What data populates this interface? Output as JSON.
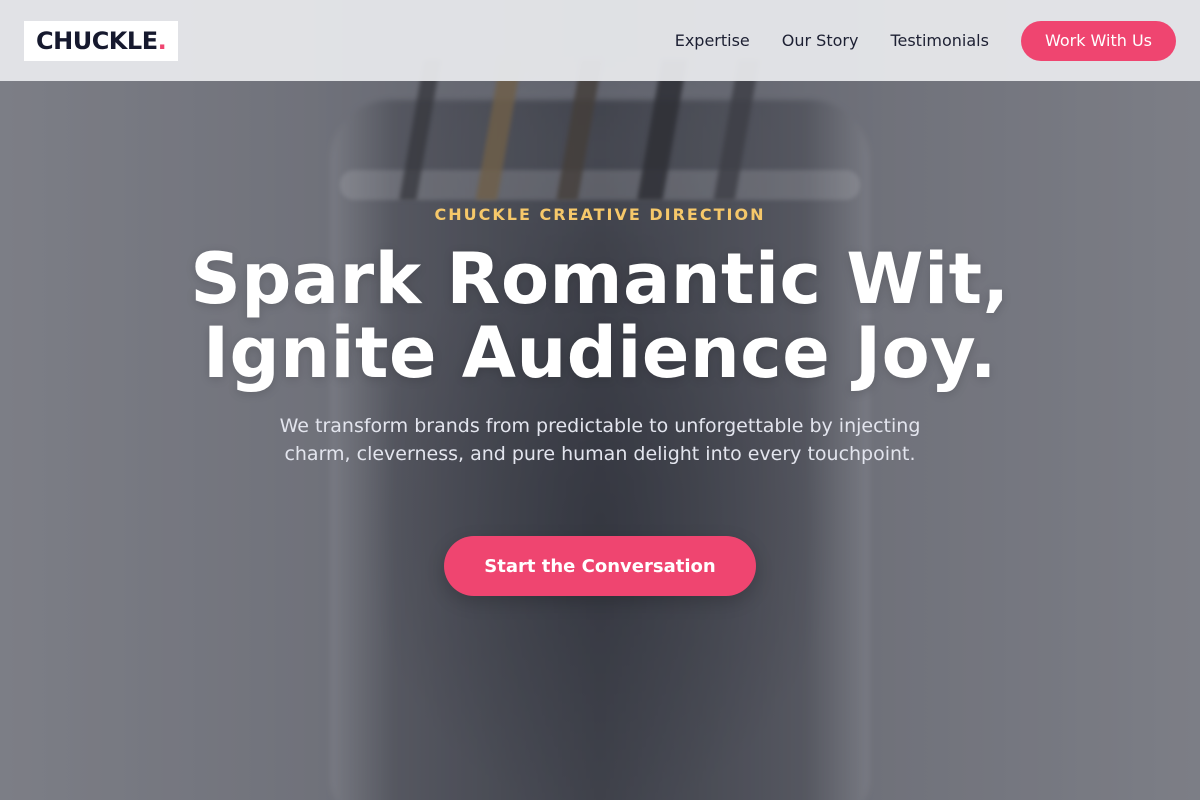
{
  "header": {
    "logo_text": "CHUCKLE",
    "logo_dot": ".",
    "nav": [
      {
        "label": "Expertise"
      },
      {
        "label": "Our Story"
      },
      {
        "label": "Testimonials"
      }
    ],
    "cta_label": "Work With Us"
  },
  "hero": {
    "eyebrow": "CHUCKLE CREATIVE DIRECTION",
    "headline_line1": "Spark Romantic Wit,",
    "headline_line2": "Ignite Audience Joy.",
    "subtext": "We transform brands from predictable to unforgettable by injecting charm, cleverness, and pure human delight into every touchpoint.",
    "cta_label": "Start the Conversation"
  },
  "colors": {
    "accent": "#ef4570",
    "eyebrow": "#f6c86a",
    "logo_text": "#16192e"
  }
}
